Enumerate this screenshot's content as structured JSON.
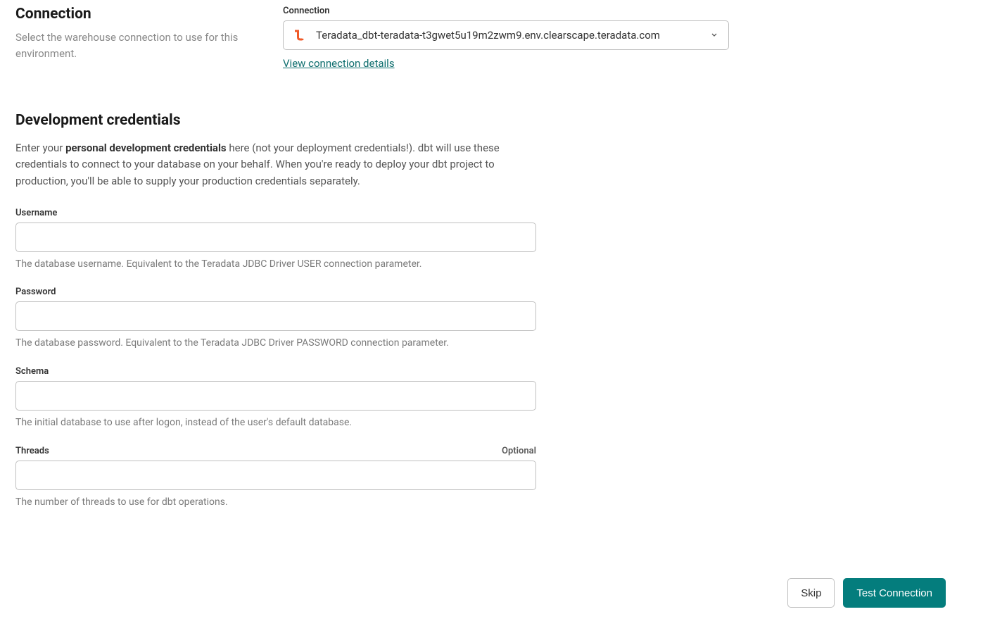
{
  "connectionSection": {
    "heading": "Connection",
    "description": "Select the warehouse connection to use for this environment.",
    "fieldLabel": "Connection",
    "selectedValue": "Teradata_dbt-teradata-t3gwet5u19m2zwm9.env.clearscape.teradata.com",
    "detailsLink": "View connection details"
  },
  "credentialsSection": {
    "heading": "Development credentials",
    "intro_prefix": "Enter your ",
    "intro_bold": "personal development credentials",
    "intro_suffix": " here (not your deployment credentials!). dbt will use these credentials to connect to your database on your behalf. When you're ready to deploy your dbt project to production, you'll be able to supply your production credentials separately.",
    "fields": {
      "username": {
        "label": "Username",
        "value": "",
        "help": "The database username. Equivalent to the Teradata JDBC Driver USER connection parameter."
      },
      "password": {
        "label": "Password",
        "value": "",
        "help": "The database password. Equivalent to the Teradata JDBC Driver PASSWORD connection parameter."
      },
      "schema": {
        "label": "Schema",
        "value": "",
        "help": "The initial database to use after logon, instead of the user's default database."
      },
      "threads": {
        "label": "Threads",
        "optional": "Optional",
        "value": "",
        "help": "The number of threads to use for dbt operations."
      }
    }
  },
  "footer": {
    "skip": "Skip",
    "test": "Test Connection"
  }
}
